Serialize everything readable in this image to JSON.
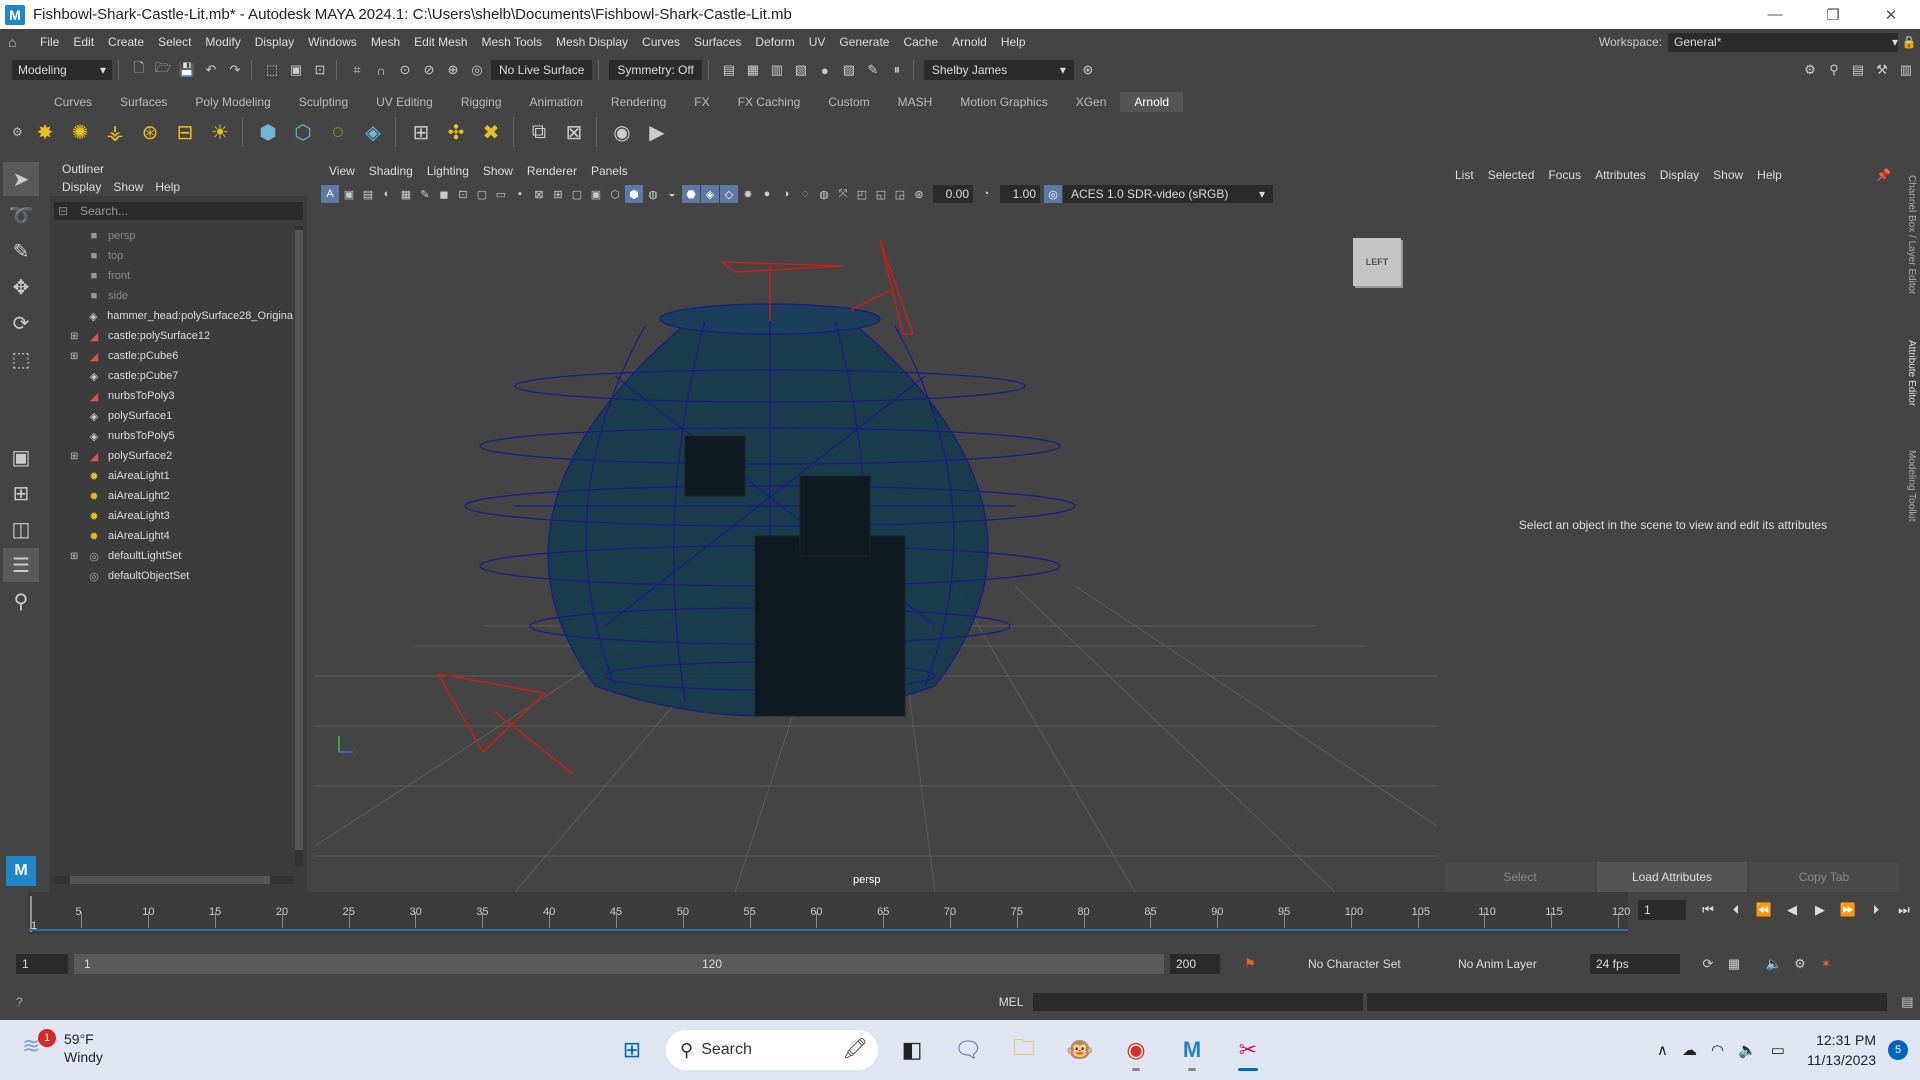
{
  "window": {
    "title": "Fishbowl-Shark-Castle-Lit.mb* - Autodesk MAYA 2024.1: C:\\Users\\shelb\\Documents\\Fishbowl-Shark-Castle-Lit.mb",
    "app_icon": "M",
    "minimize": "—",
    "restore": "❐",
    "close": "✕"
  },
  "menubar": {
    "items": [
      "File",
      "Edit",
      "Create",
      "Select",
      "Modify",
      "Display",
      "Windows",
      "Mesh",
      "Edit Mesh",
      "Mesh Tools",
      "Mesh Display",
      "Curves",
      "Surfaces",
      "Deform",
      "UV",
      "Generate",
      "Cache",
      "Arnold",
      "Help"
    ],
    "workspace_label": "Workspace:",
    "workspace_value": "General*"
  },
  "status_line": {
    "mode": "Modeling",
    "live_surface": "No Live Surface",
    "symmetry": "Symmetry: Off",
    "user": "Shelby James"
  },
  "shelf": {
    "tabs": [
      "Curves",
      "Surfaces",
      "Poly Modeling",
      "Sculpting",
      "UV Editing",
      "Rigging",
      "Animation",
      "Rendering",
      "FX",
      "FX Caching",
      "Custom",
      "MASH",
      "Motion Graphics",
      "XGen",
      "Arnold"
    ],
    "active_tab": "Arnold"
  },
  "outliner": {
    "title": "Outliner",
    "menu": [
      "Display",
      "Show",
      "Help"
    ],
    "search_placeholder": "Search...",
    "items": [
      {
        "name": "persp",
        "type": "camera",
        "dim": true,
        "expandable": false
      },
      {
        "name": "top",
        "type": "camera",
        "dim": true,
        "expandable": false
      },
      {
        "name": "front",
        "type": "camera",
        "dim": true,
        "expandable": false
      },
      {
        "name": "side",
        "type": "camera",
        "dim": true,
        "expandable": false
      },
      {
        "name": "hammer_head:polySurface28_Origina",
        "type": "mesh",
        "dim": false,
        "expandable": false
      },
      {
        "name": "castle:polySurface12",
        "type": "group",
        "dim": false,
        "expandable": true
      },
      {
        "name": "castle:pCube6",
        "type": "group",
        "dim": false,
        "expandable": true
      },
      {
        "name": "castle:pCube7",
        "type": "mesh",
        "dim": false,
        "expandable": false
      },
      {
        "name": "nurbsToPoly3",
        "type": "group",
        "dim": false,
        "expandable": false
      },
      {
        "name": "polySurface1",
        "type": "mesh",
        "dim": false,
        "expandable": false
      },
      {
        "name": "nurbsToPoly5",
        "type": "mesh",
        "dim": false,
        "expandable": false
      },
      {
        "name": "polySurface2",
        "type": "group",
        "dim": false,
        "expandable": true
      },
      {
        "name": "aiAreaLight1",
        "type": "light",
        "dim": false,
        "expandable": false
      },
      {
        "name": "aiAreaLight2",
        "type": "light",
        "dim": false,
        "expandable": false
      },
      {
        "name": "aiAreaLight3",
        "type": "light",
        "dim": false,
        "expandable": false
      },
      {
        "name": "aiAreaLight4",
        "type": "light",
        "dim": false,
        "expandable": false
      },
      {
        "name": "defaultLightSet",
        "type": "set",
        "dim": false,
        "expandable": true
      },
      {
        "name": "defaultObjectSet",
        "type": "set",
        "dim": false,
        "expandable": false
      }
    ]
  },
  "viewport": {
    "menu": [
      "View",
      "Shading",
      "Lighting",
      "Show",
      "Renderer",
      "Panels"
    ],
    "exposure": "0.00",
    "gamma": "1.00",
    "color_space": "ACES 1.0 SDR-video (sRGB)",
    "camera_label": "persp",
    "viewcube_label": "LEFT"
  },
  "attribute_editor": {
    "menu": [
      "List",
      "Selected",
      "Focus",
      "Attributes",
      "Display",
      "Show",
      "Help"
    ],
    "message": "Select an object in the scene to view and edit its attributes",
    "buttons": [
      "Select",
      "Load Attributes",
      "Copy Tab"
    ],
    "side_tabs": [
      "Channel Box / Layer Editor",
      "Attribute Editor",
      "Modeling Toolkit"
    ]
  },
  "time_slider": {
    "ticks": [
      "5",
      "10",
      "15",
      "20",
      "25",
      "30",
      "35",
      "40",
      "45",
      "50",
      "55",
      "60",
      "65",
      "70",
      "75",
      "80",
      "85",
      "90",
      "95",
      "100",
      "105",
      "110",
      "115",
      "120"
    ],
    "current_frame_label": "1",
    "current_frame": "1"
  },
  "range_slider": {
    "start": "1",
    "range_start": "1",
    "range_end": "120",
    "end": "200",
    "character_set": "No Character Set",
    "anim_layer": "No Anim Layer",
    "fps": "24 fps"
  },
  "command_line": {
    "help": "?",
    "language": "MEL"
  },
  "taskbar": {
    "weather_badge": "1",
    "temperature": "59°F",
    "condition": "Windy",
    "search_label": "Search",
    "time": "12:31 PM",
    "date": "11/13/2023",
    "notifications": "5"
  },
  "colors": {
    "accent": "#2e6fa4",
    "bowl_wire": "#1a1a8c",
    "light_wire": "#c81e1e"
  }
}
